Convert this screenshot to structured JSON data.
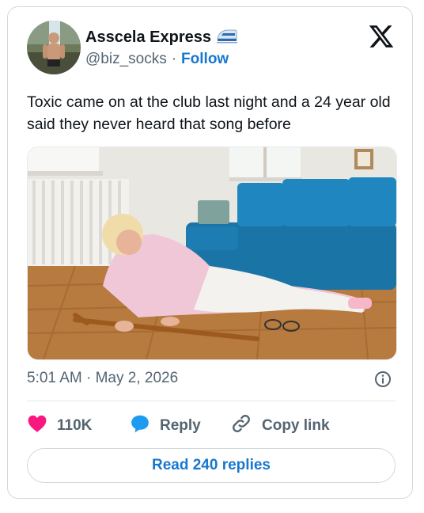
{
  "author": {
    "name": "Asscela Express",
    "handle": "@biz_socks",
    "separator": "·",
    "follow_label": "Follow"
  },
  "tweet": {
    "text": "Toxic came on at the club last night and a 24 year old said they never heard that song before"
  },
  "meta": {
    "time": "5:01 AM",
    "separator": "·",
    "date": "May 2, 2026"
  },
  "actions": {
    "likes": "110K",
    "reply_label": "Reply",
    "copy_label": "Copy link"
  },
  "replies_button": "Read 240 replies",
  "colors": {
    "accent_blue": "#1877cf",
    "like_pink": "#f91880",
    "reply_blue": "#1d9bf0",
    "secondary_text": "#536471",
    "border": "#cfd9de"
  },
  "icons": [
    "x-logo-icon",
    "train-emoji-icon",
    "info-icon",
    "heart-icon",
    "speech-bubble-icon",
    "link-icon"
  ]
}
